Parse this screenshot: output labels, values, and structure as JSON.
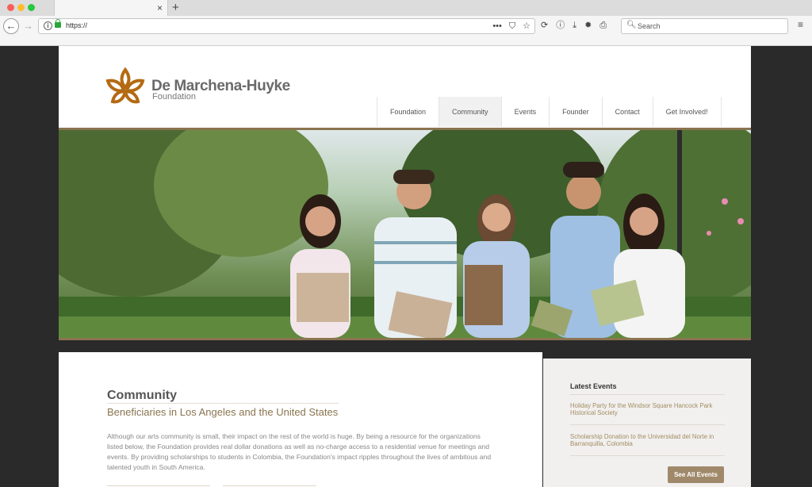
{
  "browser": {
    "new_tab_label": "+",
    "tab_close": "×",
    "url": "https://",
    "search_placeholder": "Search",
    "back_glyph": "←",
    "forward_glyph": "→",
    "menu_glyph": "≡",
    "url_icons": [
      "•••",
      "⛉",
      "☆"
    ],
    "toolbar_icons": [
      "⟳",
      "ⓘ",
      "⤓",
      "✹",
      "⎙"
    ]
  },
  "site": {
    "logo": {
      "title": "De Marchena-Huyke",
      "subtitle": "Foundation",
      "mark_color": "#b46a12",
      "icon": "lotus-logo-icon"
    },
    "nav": [
      {
        "label": "Foundation"
      },
      {
        "label": "Community",
        "active": true
      },
      {
        "label": "Events"
      },
      {
        "label": "Founder"
      },
      {
        "label": "Contact"
      },
      {
        "label": "Get Involved!"
      }
    ],
    "hero": {
      "subject": "students-photo"
    },
    "content": {
      "title": "Community",
      "subtitle": "Beneficiaries in Los Angeles and the United States",
      "paragraph": "Although our arts community is small, their impact on the rest of the world is huge. By being a resource for the organizations listed below, the Foundation provides real dollar donations as well as no-charge access to a residential venue for meetings and events. By providing scholarships to students in Colombia, the Foundation's impact ripples throughout the lives of ambitous and talented youth in South America."
    },
    "sidebar": {
      "title": "Latest Events",
      "events": [
        "Holiday Party for the Windsor Square Hancock Park Historical Society",
        "Scholarship Donation to the Universidad del Norte in Barranquilla, Colombia"
      ],
      "button_label": "See All Events"
    },
    "colors": {
      "gold": "#8a7450",
      "accent_text": "#a48c62",
      "button": "#a0896a"
    }
  }
}
